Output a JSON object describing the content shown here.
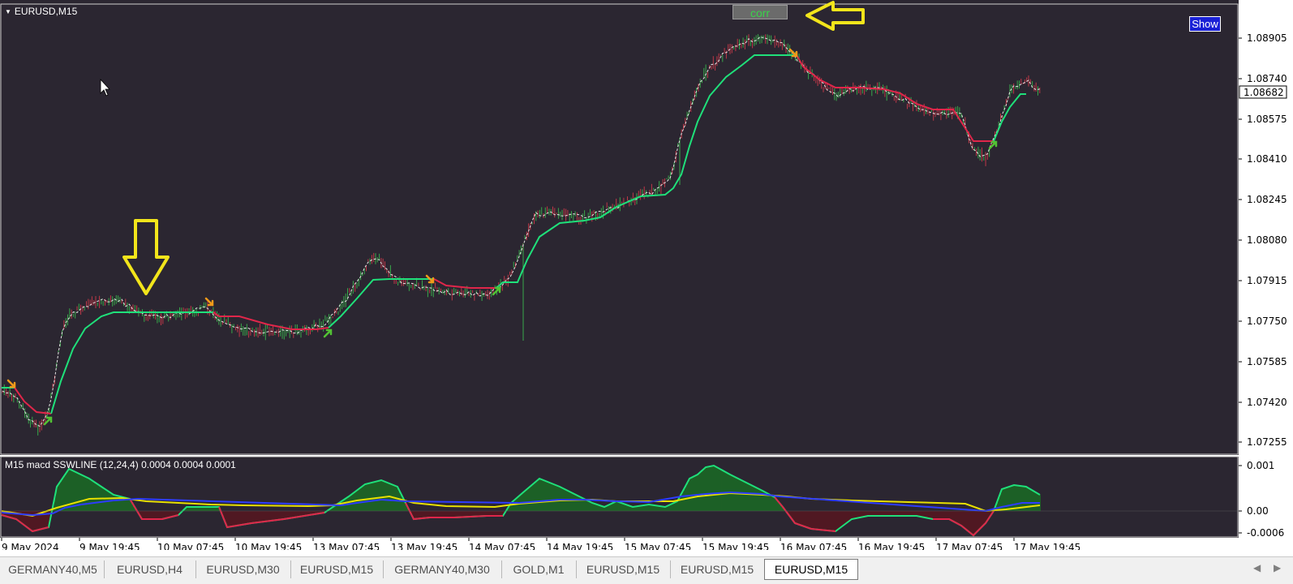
{
  "chart": {
    "symbol_title": "EURUSD,M15",
    "corr_button": "corr",
    "show_button": "Show",
    "current_price": "1.08682",
    "price_ticks": [
      "1.08905",
      "1.08740",
      "1.08575",
      "1.08410",
      "1.08245",
      "1.08080",
      "1.07915",
      "1.07750",
      "1.07585",
      "1.07420",
      "1.07255"
    ],
    "indicator_label": "M15  macd SSWLINE (12,24,4)  0.0004 0.0004 0.0001",
    "indicator_ticks": [
      "0.001",
      "0.00",
      "-0.0006"
    ],
    "time_ticks": [
      "9 May 2024",
      "9 May 19:45",
      "10 May 07:45",
      "10 May 19:45",
      "13 May 07:45",
      "13 May 19:45",
      "14 May 07:45",
      "14 May 19:45",
      "15 May 07:45",
      "15 May 19:45",
      "16 May 07:45",
      "16 May 19:45",
      "17 May 07:45",
      "17 May 19:45"
    ]
  },
  "colors": {
    "chart_bg": "#2b2631",
    "bull_line": "#1fe07a",
    "bear_line": "#e0264a",
    "candle_up": "#38a84a",
    "candle_down": "#c03848",
    "annotation": "#f2e51b",
    "macd_main": "#2d3cff",
    "macd_signal": "#e8e000",
    "hist_up": "#14871f",
    "hist_down": "#6a1018",
    "active_tab": "#ffffff"
  },
  "tabs": [
    {
      "label": "GERMANY40,M5",
      "active": false
    },
    {
      "label": "EURUSD,H4",
      "active": false
    },
    {
      "label": "EURUSD,M30",
      "active": false
    },
    {
      "label": "EURUSD,M15",
      "active": false
    },
    {
      "label": "GERMANY40,M30",
      "active": false
    },
    {
      "label": "GOLD,M1",
      "active": false
    },
    {
      "label": "EURUSD,M15",
      "active": false
    },
    {
      "label": "EURUSD,M15",
      "active": false
    },
    {
      "label": "EURUSD,M15",
      "active": true
    }
  ],
  "icons": {
    "dropdown": "triangle-down-icon",
    "cursor": "mouse-pointer-icon",
    "scroll_left": "chevron-left-icon",
    "scroll_right": "chevron-right-icon"
  }
}
